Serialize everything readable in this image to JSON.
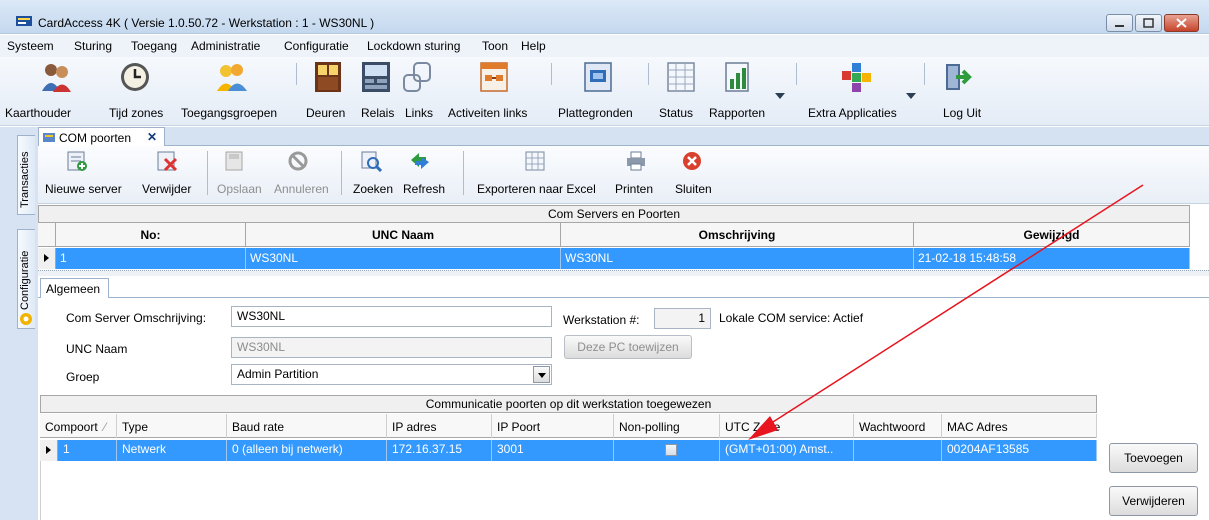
{
  "window": {
    "title": "CardAccess 4K ( Versie 1.0.50.72  -  Werkstation : 1 - WS30NL )"
  },
  "menu": {
    "items": [
      "Systeem",
      "Sturing",
      "Toegang",
      "Administratie",
      "Configuratie",
      "Lockdown sturing",
      "Toon",
      "Help"
    ]
  },
  "toolbar": {
    "items": [
      {
        "label": "Kaarthouder",
        "icon": "cardholder-icon"
      },
      {
        "label": "Tijd zones",
        "icon": "clock-icon"
      },
      {
        "label": "Toegangsgroepen",
        "icon": "access-groups-icon"
      },
      {
        "label": "Deuren",
        "icon": "door-icon"
      },
      {
        "label": "Relais",
        "icon": "relay-icon"
      },
      {
        "label": "Links",
        "icon": "link-icon"
      },
      {
        "label": "Activeiten links",
        "icon": "activity-links-icon"
      },
      {
        "label": "Plattegronden",
        "icon": "floorplan-icon"
      },
      {
        "label": "Status",
        "icon": "status-grid-icon"
      },
      {
        "label": "Rapporten",
        "icon": "reports-icon"
      },
      {
        "label": "Extra Applicaties",
        "icon": "extra-apps-icon"
      },
      {
        "label": "Log Uit",
        "icon": "logout-icon"
      }
    ]
  },
  "side_tabs": [
    "Transacties",
    "Configuratie"
  ],
  "doc_tab": {
    "label": "COM poorten",
    "close": "✕"
  },
  "sub_toolbar": {
    "items": [
      {
        "label": "Nieuwe server",
        "icon": "new-server-icon",
        "enabled": true
      },
      {
        "label": "Verwijder",
        "icon": "delete-icon",
        "enabled": true
      },
      {
        "label": "Opslaan",
        "icon": "save-icon",
        "enabled": false
      },
      {
        "label": "Annuleren",
        "icon": "cancel-icon",
        "enabled": false
      },
      {
        "label": "Zoeken",
        "icon": "search-icon",
        "enabled": true
      },
      {
        "label": "Refresh",
        "icon": "refresh-icon",
        "enabled": true
      },
      {
        "label": "Exporteren naar Excel",
        "icon": "excel-export-icon",
        "enabled": true
      },
      {
        "label": "Printen",
        "icon": "printer-icon",
        "enabled": true
      },
      {
        "label": "Sluiten",
        "icon": "close-circle-icon",
        "enabled": true
      }
    ]
  },
  "servers_grid": {
    "title": "Com Servers en Poorten",
    "columns": [
      "No:",
      "UNC Naam",
      "Omschrijving",
      "Gewijzigd"
    ],
    "rows": [
      {
        "no": "1",
        "unc": "WS30NL",
        "desc": "WS30NL",
        "changed": "21-02-18 15:48:58"
      }
    ]
  },
  "detail": {
    "tab": "Algemeen",
    "desc_label": "Com Server Omschrijving:",
    "desc_value": "WS30NL",
    "workstation_label": "Werkstation #:",
    "workstation_value": "1",
    "local_service": "Lokale COM service:  Actief",
    "unc_label": "UNC Naam",
    "unc_value": "WS30NL",
    "assign_button": "Deze PC toewijzen",
    "group_label": "Groep",
    "group_value": "Admin Partition"
  },
  "ports_grid": {
    "title": "Communicatie poorten op dit werkstation toegewezen",
    "columns": [
      "Compoort",
      "Type",
      "Baud rate",
      "IP adres",
      "IP Poort",
      "Non-polling",
      "UTC Zone",
      "Wachtwoord",
      "MAC Adres"
    ],
    "sort_indicator": "⁄",
    "rows": [
      {
        "port": "1",
        "type": "Netwerk",
        "baud": "0 (alleen bij netwerk)",
        "ip": "172.16.37.15",
        "ipport": "3001",
        "nonpolling": false,
        "utc": "(GMT+01:00)  Amst..",
        "password": "",
        "mac": "00204AF13585"
      }
    ]
  },
  "buttons": {
    "add": "Toevoegen",
    "remove": "Verwijderen"
  },
  "colors": {
    "selection": "#3399ff",
    "annotation_arrow": "#e8141e"
  }
}
